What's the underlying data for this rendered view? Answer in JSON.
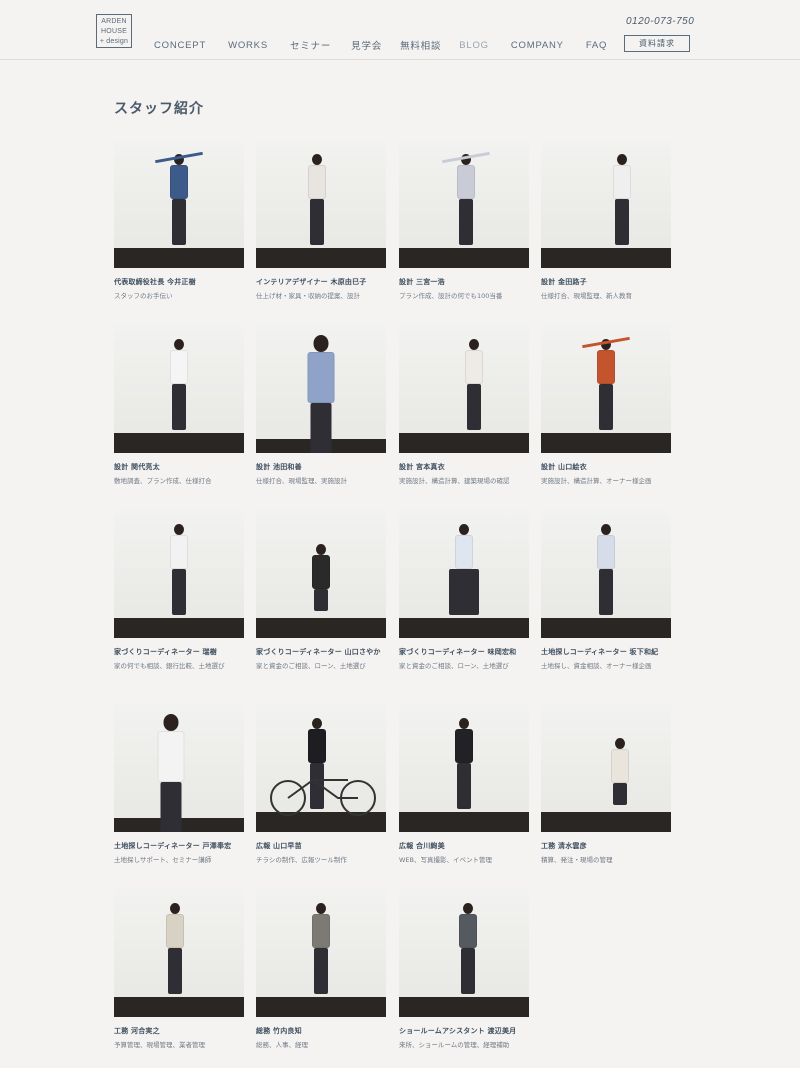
{
  "header": {
    "logo": [
      "ARDEN",
      "HOUSE",
      "+ design"
    ],
    "nav": [
      {
        "label": "CONCEPT",
        "muted": false
      },
      {
        "label": "WORKS",
        "muted": false
      },
      {
        "label": "セミナー",
        "muted": false
      },
      {
        "label": "見学会",
        "muted": false
      },
      {
        "label": "無料相談",
        "muted": false
      },
      {
        "label": "BLOG",
        "muted": true
      },
      {
        "label": "COMPANY",
        "muted": false
      },
      {
        "label": "FAQ",
        "muted": false
      }
    ],
    "phone": "0120-073-750",
    "request_label": "資料請求"
  },
  "page_title": "スタッフ紹介",
  "staff": [
    {
      "title": "代表取締役社長 今井正樹",
      "desc": "スタッフのお手伝い",
      "shirt": "#3c5a8a"
    },
    {
      "title": "インテリアデザイナー 木原由巳子",
      "desc": "仕上げ材・家具・収納の提案、設計",
      "shirt": "#e8e4df"
    },
    {
      "title": "設計 三宮一浩",
      "desc": "プラン作成、設計の何でも100当番",
      "shirt": "#c9ccd6"
    },
    {
      "title": "設計 金田路子",
      "desc": "仕様打合、現場監理、新人教育",
      "shirt": "#efefef"
    },
    {
      "title": "設計 関代亮太",
      "desc": "敷地調査、プラン作成、仕様打合",
      "shirt": "#f5f5f5"
    },
    {
      "title": "設計 池田和善",
      "desc": "仕様打合、現場監理、実施設計",
      "shirt": "#8fa3c9"
    },
    {
      "title": "設計 宮本真衣",
      "desc": "実施設計、構造計算、建築現場の確認",
      "shirt": "#eeeae4"
    },
    {
      "title": "設計 山口絵衣",
      "desc": "実施設計、構造計算、オーナー様企画",
      "shirt": "#c4542e"
    },
    {
      "title": "家づくりコーディネーター 瑞樹",
      "desc": "家の何でも相談、銀行比較、土地選び",
      "shirt": "#f2f2f2"
    },
    {
      "title": "家づくりコーディネーター 山口さやか",
      "desc": "家と資金のご相談、ローン、土地選び",
      "shirt": "#2a2a2a"
    },
    {
      "title": "家づくりコーディネーター 味岡宏和",
      "desc": "家と資金のご相談、ローン、土地選び",
      "shirt": "#dfe6ef"
    },
    {
      "title": "土地探しコーディネーター 坂下和紀",
      "desc": "土地探し、資金相談、オーナー様企画",
      "shirt": "#d7dde8"
    },
    {
      "title": "土地探しコーディネーター 戸澤奉宏",
      "desc": "土地探しサポート、セミナー講師",
      "shirt": "#f3f3f3"
    },
    {
      "title": "広報 山口早苗",
      "desc": "チラシの制作、広報ツール制作",
      "shirt": "#1e1e22"
    },
    {
      "title": "広報 合川絢美",
      "desc": "WEB、写真撮影、イベント管理",
      "shirt": "#222226"
    },
    {
      "title": "工務 清水雲彦",
      "desc": "積算、発注・現場の管理",
      "shirt": "#e9e4dc"
    },
    {
      "title": "工務 河合実之",
      "desc": "予算管理、現場管理、業者管理",
      "shirt": "#d8d2c4"
    },
    {
      "title": "総務 竹内良知",
      "desc": "総務、人事、経理",
      "shirt": "#7d7a74"
    },
    {
      "title": "ショールームアシスタント 渡辺美月",
      "desc": "来所、ショールームの管理、経理補助",
      "shirt": "#555a60"
    }
  ]
}
